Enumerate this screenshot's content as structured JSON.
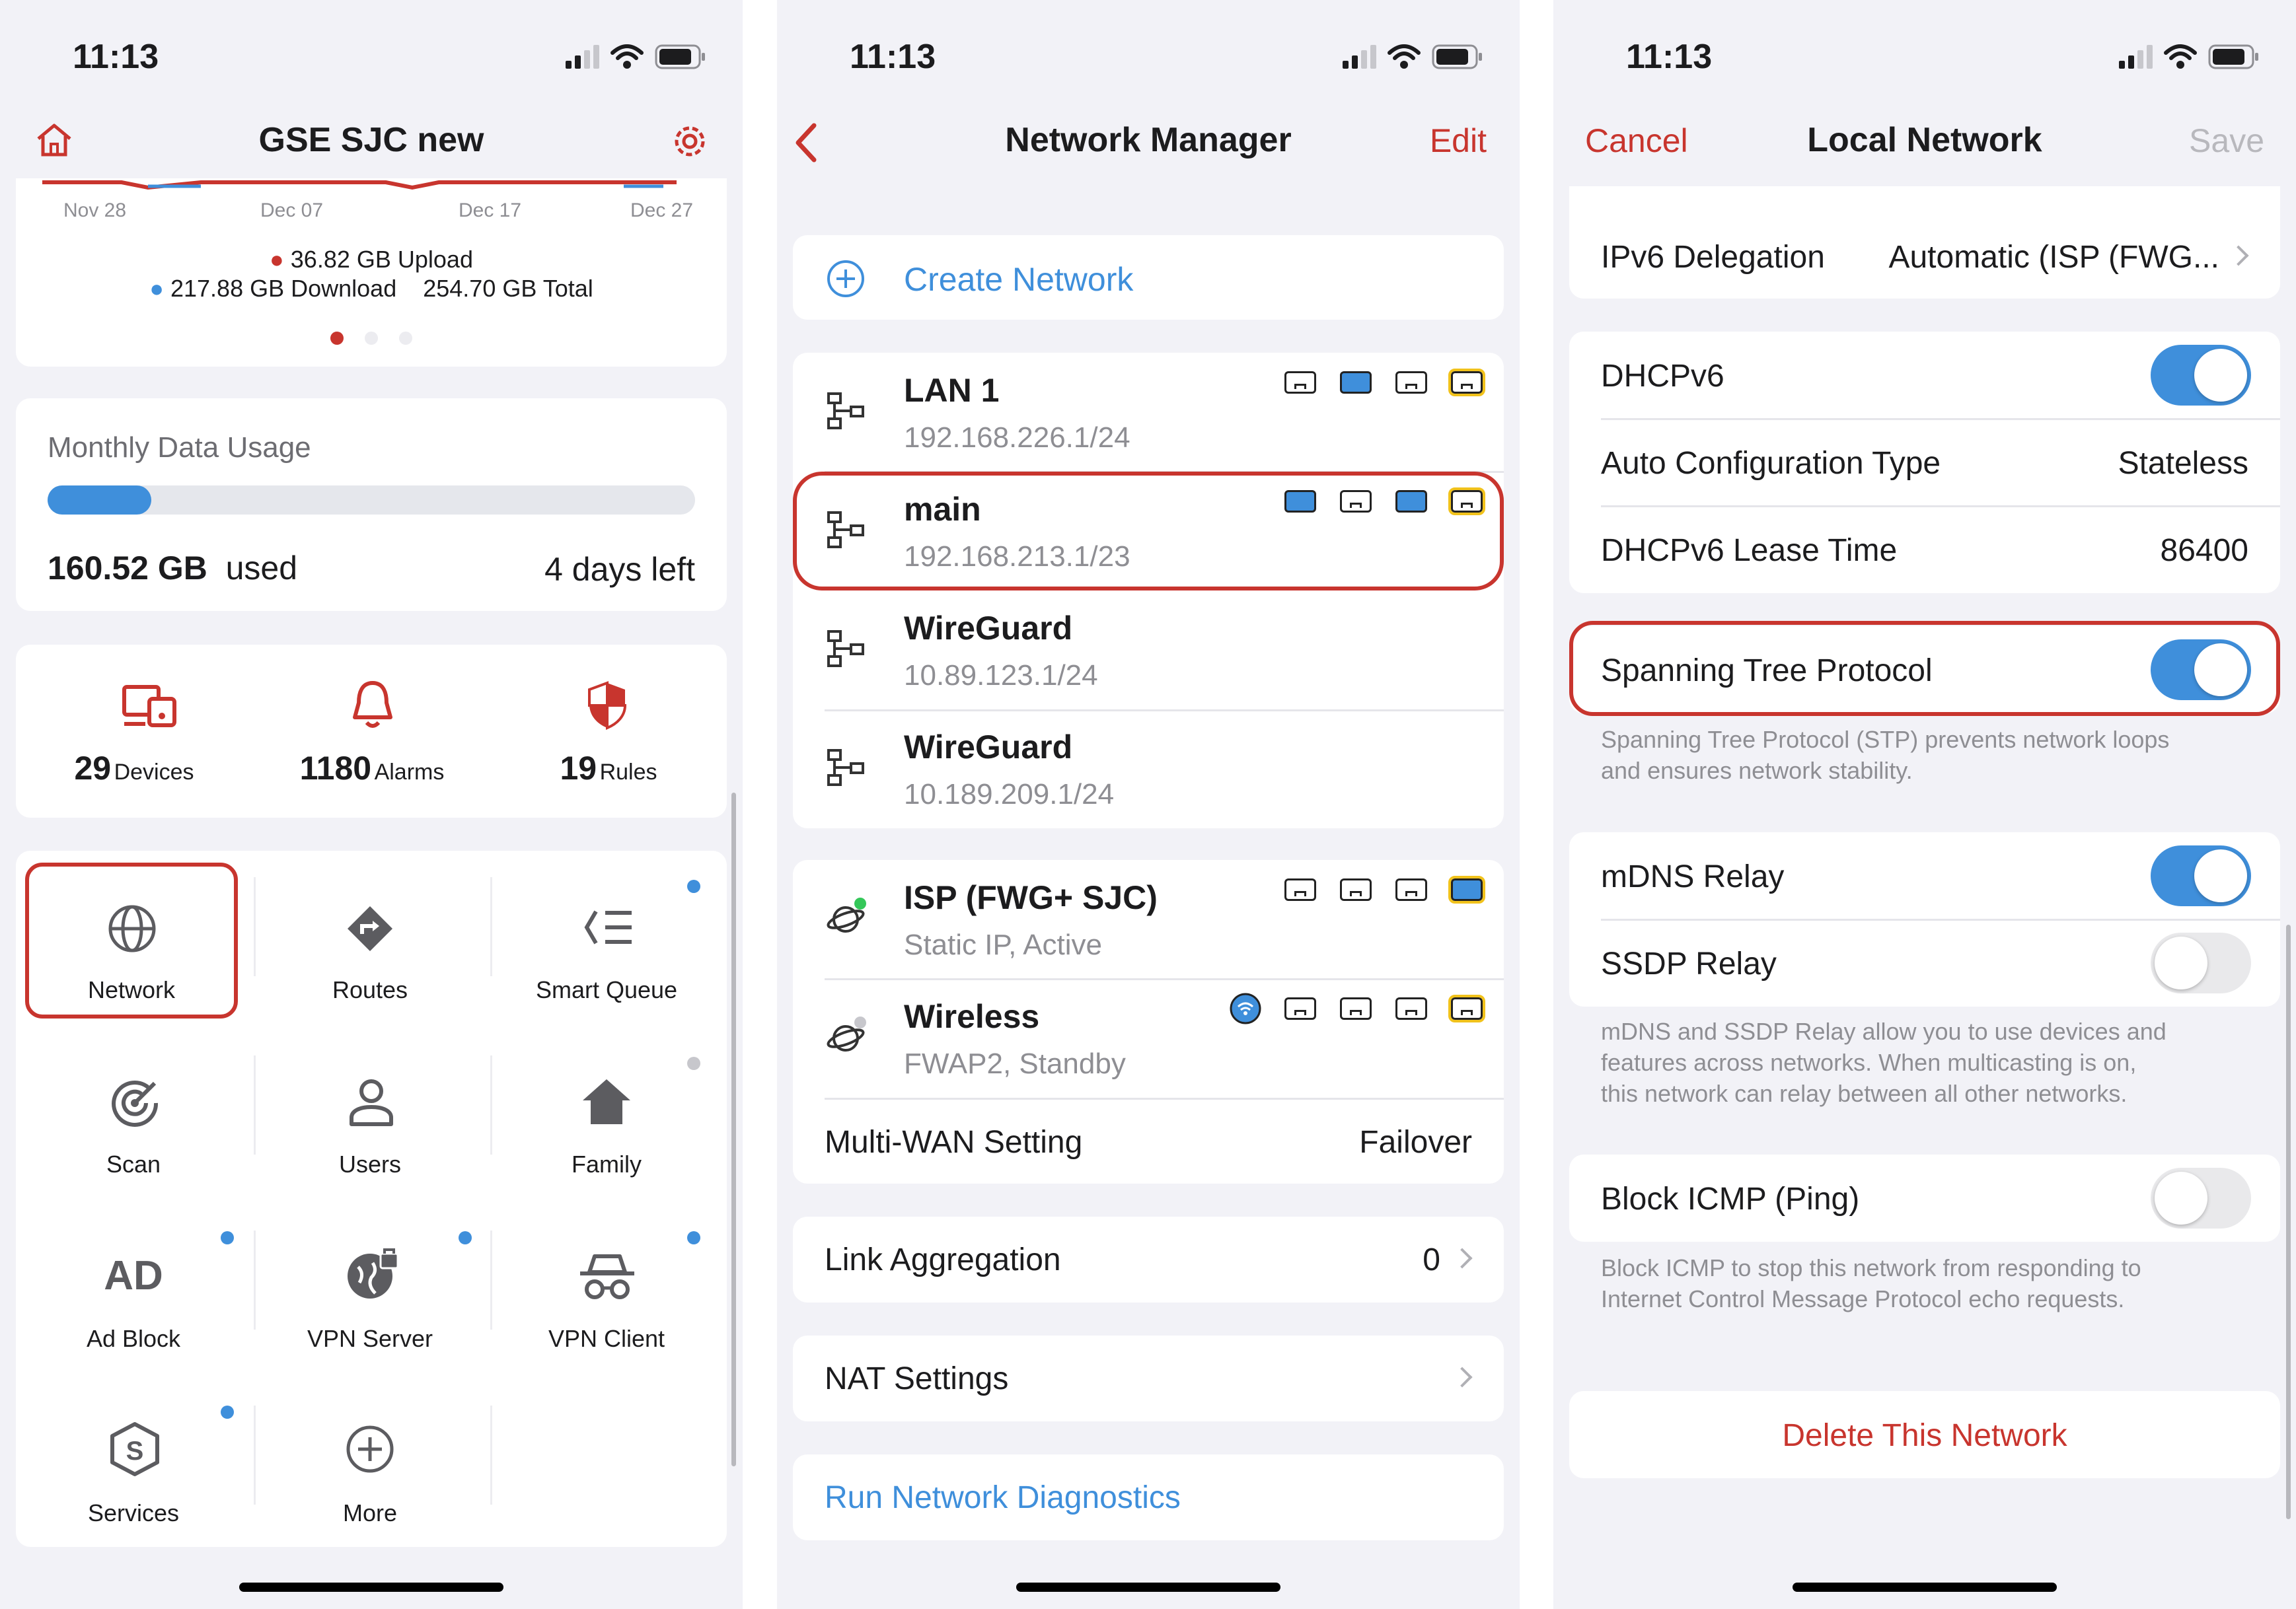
{
  "status": {
    "time": "11:13"
  },
  "p1": {
    "title": "GSE SJC new",
    "chart": {
      "dates": [
        "Nov 28",
        "Dec 07",
        "Dec 17",
        "Dec 27"
      ],
      "upload": "36.82 GB Upload",
      "download": "217.88 GB Download",
      "total": "254.70 GB Total"
    },
    "monthly": {
      "label": "Monthly Data Usage",
      "used_value": "160.52 GB",
      "used_label": "used",
      "days_left": "4 days left",
      "progress": 0.16
    },
    "stats": [
      {
        "num": "29",
        "label": "Devices"
      },
      {
        "num": "1180",
        "label": "Alarms"
      },
      {
        "num": "19",
        "label": "Rules"
      }
    ],
    "grid": [
      {
        "label": "Network"
      },
      {
        "label": "Routes"
      },
      {
        "label": "Smart Queue"
      },
      {
        "label": "Scan"
      },
      {
        "label": "Users"
      },
      {
        "label": "Family"
      },
      {
        "label": "Ad Block",
        "icon_text": "AD"
      },
      {
        "label": "VPN Server"
      },
      {
        "label": "VPN Client"
      },
      {
        "label": "Services"
      },
      {
        "label": "More"
      }
    ]
  },
  "p2": {
    "title": "Network Manager",
    "edit": "Edit",
    "create": "Create Network",
    "networks": [
      {
        "name": "LAN 1",
        "ip": "192.168.226.1/24"
      },
      {
        "name": "main",
        "ip": "192.168.213.1/23"
      },
      {
        "name": "WireGuard",
        "ip": "10.89.123.1/24"
      },
      {
        "name": "WireGuard",
        "ip": "10.189.209.1/24"
      }
    ],
    "wan": [
      {
        "name": "ISP (FWG+ SJC)",
        "sub": "Static IP, Active"
      },
      {
        "name": "Wireless",
        "sub": "FWAP2, Standby"
      }
    ],
    "multiwan": {
      "label": "Multi-WAN Setting",
      "value": "Failover"
    },
    "link": {
      "label": "Link Aggregation",
      "value": "0"
    },
    "nat": "NAT Settings",
    "diag": "Run Network Diagnostics"
  },
  "p3": {
    "cancel": "Cancel",
    "title": "Local Network",
    "save": "Save",
    "ipv6": {
      "label": "IPv6 Delegation",
      "value": "Automatic (ISP (FWG..."
    },
    "dhcpv6": "DHCPv6",
    "autoconf": {
      "label": "Auto Configuration Type",
      "value": "Stateless"
    },
    "lease": {
      "label": "DHCPv6 Lease Time",
      "value": "86400"
    },
    "stp": {
      "label": "Spanning Tree Protocol",
      "desc1": "Spanning Tree Protocol (STP) prevents network loops",
      "desc2": "and ensures network stability."
    },
    "mdns": "mDNS Relay",
    "ssdp": "SSDP Relay",
    "relay_desc": [
      "mDNS and SSDP Relay allow you to use devices and",
      "features across networks. When multicasting is on,",
      "this network can relay between all other networks."
    ],
    "icmp": {
      "label": "Block ICMP (Ping)",
      "desc1": "Block ICMP to stop this network from responding to",
      "desc2": "Internet Control Message Protocol echo requests."
    },
    "delete": "Delete This Network"
  },
  "colors": {
    "accent": "#c8352e",
    "blue": "#3f8fdb",
    "link": "#3f8fdb"
  }
}
